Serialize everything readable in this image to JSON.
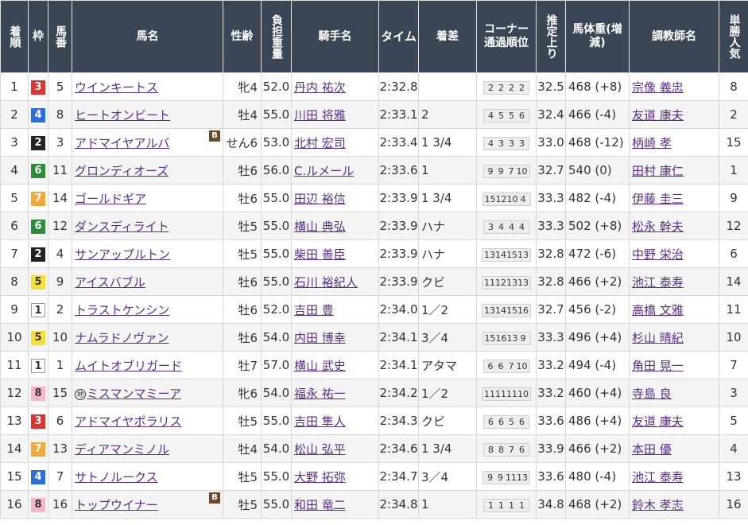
{
  "headers": {
    "rank": "着順",
    "waku": "枠",
    "umaban": "馬番",
    "horse": "馬名",
    "sexage": "性齢",
    "weight": "負担重量",
    "jockey": "騎手名",
    "time": "タイム",
    "margin": "着差",
    "corner": "コーナー通過順位",
    "last3f": "推定上り",
    "body": "馬体重(増減)",
    "trainer": "調教師名",
    "pop": "単勝人気"
  },
  "colors": {
    "header_bg": "#3a4656",
    "waku_1": "#ffffff",
    "waku_2": "#222222",
    "waku_3": "#dd3333",
    "waku_4": "#2a6fdb",
    "waku_5": "#f5e03a",
    "waku_6": "#2e8b3a",
    "waku_7": "#f2a93b",
    "waku_8": "#f5b7c8",
    "link": "#5a2e8a"
  },
  "rows": [
    {
      "rank": "1",
      "waku": "3",
      "umaban": "5",
      "horse": "ウインキートス",
      "blinker": false,
      "chihou": false,
      "sexage": "牝4",
      "weight": "52.0",
      "jockey": "丹内 祐次",
      "time": "2:32.8",
      "margin": "",
      "corner": [
        "2",
        "2",
        "2",
        "2"
      ],
      "last3f": "32.5",
      "body": "468 (+8)",
      "trainer": "宗像 義忠",
      "pop": "8"
    },
    {
      "rank": "2",
      "waku": "4",
      "umaban": "8",
      "horse": "ヒートオンビート",
      "blinker": false,
      "chihou": false,
      "sexage": "牡4",
      "weight": "55.0",
      "jockey": "川田 将雅",
      "time": "2:33.1",
      "margin": "2",
      "corner": [
        "4",
        "5",
        "5",
        "6"
      ],
      "last3f": "32.4",
      "body": "466 (-4)",
      "trainer": "友道 康夫",
      "pop": "2"
    },
    {
      "rank": "3",
      "waku": "2",
      "umaban": "3",
      "horse": "アドマイヤアルバ",
      "blinker": true,
      "chihou": false,
      "sexage": "せん6",
      "weight": "53.0",
      "jockey": "北村 宏司",
      "time": "2:33.4",
      "margin": "1 3/4",
      "corner": [
        "4",
        "3",
        "3",
        "3"
      ],
      "last3f": "33.0",
      "body": "468 (-12)",
      "trainer": "柄崎 孝",
      "pop": "15"
    },
    {
      "rank": "4",
      "waku": "6",
      "umaban": "11",
      "horse": "グロンディオーズ",
      "blinker": false,
      "chihou": false,
      "sexage": "牡6",
      "weight": "56.0",
      "jockey": "C.ルメール",
      "time": "2:33.6",
      "margin": "1",
      "corner": [
        "9",
        "9",
        "7",
        "10"
      ],
      "last3f": "32.7",
      "body": "540 (0)",
      "trainer": "田村 康仁",
      "pop": "1"
    },
    {
      "rank": "5",
      "waku": "7",
      "umaban": "14",
      "horse": "ゴールドギア",
      "blinker": false,
      "chihou": false,
      "sexage": "牡6",
      "weight": "55.0",
      "jockey": "田辺 裕信",
      "time": "2:33.9",
      "margin": "1 3/4",
      "corner": [
        "15",
        "12",
        "10",
        "4"
      ],
      "last3f": "33.3",
      "body": "482 (-4)",
      "trainer": "伊藤 圭三",
      "pop": "9"
    },
    {
      "rank": "6",
      "waku": "6",
      "umaban": "12",
      "horse": "ダンスディライト",
      "blinker": false,
      "chihou": false,
      "sexage": "牡5",
      "weight": "55.0",
      "jockey": "横山 典弘",
      "time": "2:33.9",
      "margin": "ハナ",
      "corner": [
        "3",
        "4",
        "4",
        "4"
      ],
      "last3f": "33.3",
      "body": "502 (+8)",
      "trainer": "松永 幹夫",
      "pop": "12"
    },
    {
      "rank": "7",
      "waku": "2",
      "umaban": "4",
      "horse": "サンアップルトン",
      "blinker": false,
      "chihou": false,
      "sexage": "牡5",
      "weight": "55.0",
      "jockey": "柴田 善臣",
      "time": "2:33.9",
      "margin": "ハナ",
      "corner": [
        "13",
        "14",
        "15",
        "13"
      ],
      "last3f": "32.8",
      "body": "472 (-6)",
      "trainer": "中野 栄治",
      "pop": "6"
    },
    {
      "rank": "8",
      "waku": "5",
      "umaban": "9",
      "horse": "アイスバブル",
      "blinker": false,
      "chihou": false,
      "sexage": "牡6",
      "weight": "55.0",
      "jockey": "石川 裕紀人",
      "time": "2:33.9",
      "margin": "クビ",
      "corner": [
        "11",
        "12",
        "13",
        "13"
      ],
      "last3f": "32.8",
      "body": "466 (+2)",
      "trainer": "池江 泰寿",
      "pop": "14"
    },
    {
      "rank": "9",
      "waku": "1",
      "umaban": "2",
      "horse": "トラストケンシン",
      "blinker": false,
      "chihou": false,
      "sexage": "牡6",
      "weight": "52.0",
      "jockey": "吉田 豊",
      "time": "2:34.0",
      "margin": "1／2",
      "corner": [
        "13",
        "14",
        "15",
        "16"
      ],
      "last3f": "32.7",
      "body": "456 (-2)",
      "trainer": "高橋 文雅",
      "pop": "11"
    },
    {
      "rank": "10",
      "waku": "5",
      "umaban": "10",
      "horse": "ナムラドノヴァン",
      "blinker": false,
      "chihou": false,
      "sexage": "牡6",
      "weight": "54.0",
      "jockey": "内田 博幸",
      "time": "2:34.1",
      "margin": "3／4",
      "corner": [
        "15",
        "16",
        "13",
        "9"
      ],
      "last3f": "33.3",
      "body": "496 (+4)",
      "trainer": "杉山 晴紀",
      "pop": "10"
    },
    {
      "rank": "11",
      "waku": "1",
      "umaban": "1",
      "horse": "ムイトオブリガード",
      "blinker": false,
      "chihou": false,
      "sexage": "牡7",
      "weight": "57.0",
      "jockey": "横山 武史",
      "time": "2:34.1",
      "margin": "アタマ",
      "corner": [
        "6",
        "6",
        "7",
        "10"
      ],
      "last3f": "33.2",
      "body": "494 (-4)",
      "trainer": "角田 晃一",
      "pop": "7"
    },
    {
      "rank": "12",
      "waku": "8",
      "umaban": "15",
      "horse": "ミスマンマミーア",
      "blinker": false,
      "chihou": true,
      "sexage": "牝6",
      "weight": "54.0",
      "jockey": "福永 祐一",
      "time": "2:34.2",
      "margin": "1／2",
      "corner": [
        "11",
        "11",
        "11",
        "10"
      ],
      "last3f": "33.2",
      "body": "460 (+4)",
      "trainer": "寺島 良",
      "pop": "3"
    },
    {
      "rank": "13",
      "waku": "3",
      "umaban": "6",
      "horse": "アドマイヤポラリス",
      "blinker": false,
      "chihou": false,
      "sexage": "牡5",
      "weight": "55.0",
      "jockey": "吉田 隼人",
      "time": "2:34.3",
      "margin": "クビ",
      "corner": [
        "6",
        "6",
        "5",
        "6"
      ],
      "last3f": "33.6",
      "body": "486 (+4)",
      "trainer": "友道 康夫",
      "pop": "5"
    },
    {
      "rank": "14",
      "waku": "7",
      "umaban": "13",
      "horse": "ディアマンミノル",
      "blinker": false,
      "chihou": false,
      "sexage": "牡4",
      "weight": "54.0",
      "jockey": "松山 弘平",
      "time": "2:34.6",
      "margin": "1 3/4",
      "corner": [
        "8",
        "8",
        "7",
        "6"
      ],
      "last3f": "33.9",
      "body": "466 (+2)",
      "trainer": "本田 優",
      "pop": "4"
    },
    {
      "rank": "15",
      "waku": "4",
      "umaban": "7",
      "horse": "サトノルークス",
      "blinker": false,
      "chihou": false,
      "sexage": "牡5",
      "weight": "55.0",
      "jockey": "大野 拓弥",
      "time": "2:34.7",
      "margin": "3／4",
      "corner": [
        "9",
        "9",
        "11",
        "13"
      ],
      "last3f": "33.6",
      "body": "480 (-4)",
      "trainer": "池江 泰寿",
      "pop": "13"
    },
    {
      "rank": "16",
      "waku": "8",
      "umaban": "16",
      "horse": "トップウイナー",
      "blinker": true,
      "chihou": false,
      "sexage": "牡5",
      "weight": "55.0",
      "jockey": "和田 竜二",
      "time": "2:34.8",
      "margin": "1",
      "corner": [
        "1",
        "1",
        "1",
        "1"
      ],
      "last3f": "34.8",
      "body": "468 (+2)",
      "trainer": "鈴木 孝志",
      "pop": "16"
    }
  ],
  "badges": {
    "blinker": "B",
    "chihou": "地"
  }
}
